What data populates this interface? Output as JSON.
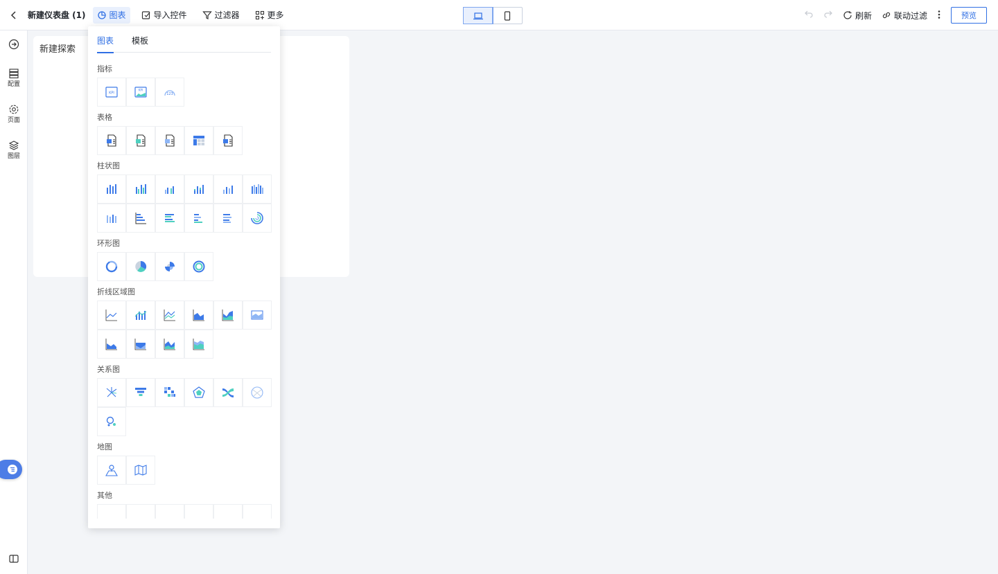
{
  "header": {
    "title": "新建仪表盘 (1)",
    "chart_btn": "图表",
    "import_btn": "导入控件",
    "filter_btn": "过滤器",
    "more_btn": "更多",
    "refresh_btn": "刷新",
    "linked_filter_btn": "联动过滤",
    "preview_btn": "预览"
  },
  "sidebar": {
    "config": "配置",
    "page": "页面",
    "layers": "图层"
  },
  "canvas": {
    "card_title": "新建探索"
  },
  "popup": {
    "tabs": [
      "图表",
      "模板"
    ],
    "sections": {
      "indicator": "指标",
      "table": "表格",
      "bar": "柱状图",
      "ring": "环形图",
      "line_area": "折线区域图",
      "relation": "关系图",
      "map": "地图",
      "other": "其他"
    }
  },
  "colors": {
    "accent": "#2f6fe4",
    "chart_blue": "#3d7ae8",
    "chart_light": "#8fb6f5",
    "chart_teal": "#4fd0c0"
  }
}
